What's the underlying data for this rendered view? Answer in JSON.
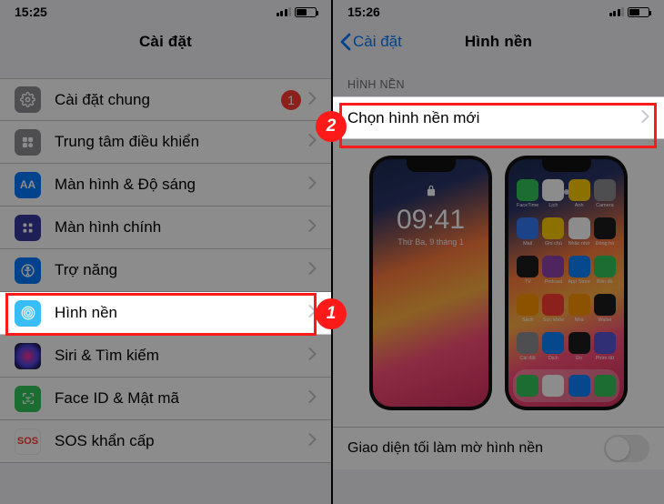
{
  "left": {
    "time": "15:25",
    "title": "Cài đặt",
    "items": {
      "general": "Cài đặt chung",
      "control": "Trung tâm điều khiển",
      "display": "Màn hình & Độ sáng",
      "home": "Màn hình chính",
      "access": "Trợ năng",
      "wallpaper": "Hình nền",
      "siri": "Siri & Tìm kiếm",
      "face": "Face ID & Mật mã",
      "sos": "SOS khẩn cấp"
    },
    "general_badge": "1"
  },
  "right": {
    "time": "15:26",
    "back": "Cài đặt",
    "title": "Hình nền",
    "section": "HÌNH NỀN",
    "choose": "Chọn hình nền mới",
    "lock_time": "09:41",
    "lock_date": "Thứ Ba, 9 tháng 1",
    "toggle_label": "Giao diện tối làm mờ hình nền",
    "apps": [
      "FaceTime",
      "Lịch",
      "Ảnh",
      "Camera",
      "Mail",
      "Ghi chú",
      "Nhắc nhở",
      "Đồng hồ",
      "TV",
      "Podcast",
      "App Store",
      "Bản đồ",
      "Sách",
      "Sức khỏe",
      "Nhà",
      "Wallet",
      "Cài đặt",
      "Dịch",
      "Đo",
      "Phím tắt"
    ],
    "app_colors": [
      "#34c759",
      "#ffffff",
      "#ffcc00",
      "#8e8e93",
      "#3478f6",
      "#ffcc00",
      "#ffffff",
      "#1c1c1e",
      "#1c1c1e",
      "#8e44ad",
      "#0a84ff",
      "#34c759",
      "#ff9500",
      "#ff3b30",
      "#ff9500",
      "#1c1c1e",
      "#8e8e93",
      "#0a84ff",
      "#1c1c1e",
      "#5856d6"
    ],
    "dock_colors": [
      "#34c759",
      "#ffffff",
      "#0a84ff",
      "#34c759"
    ]
  },
  "callouts": {
    "one": "1",
    "two": "2"
  }
}
